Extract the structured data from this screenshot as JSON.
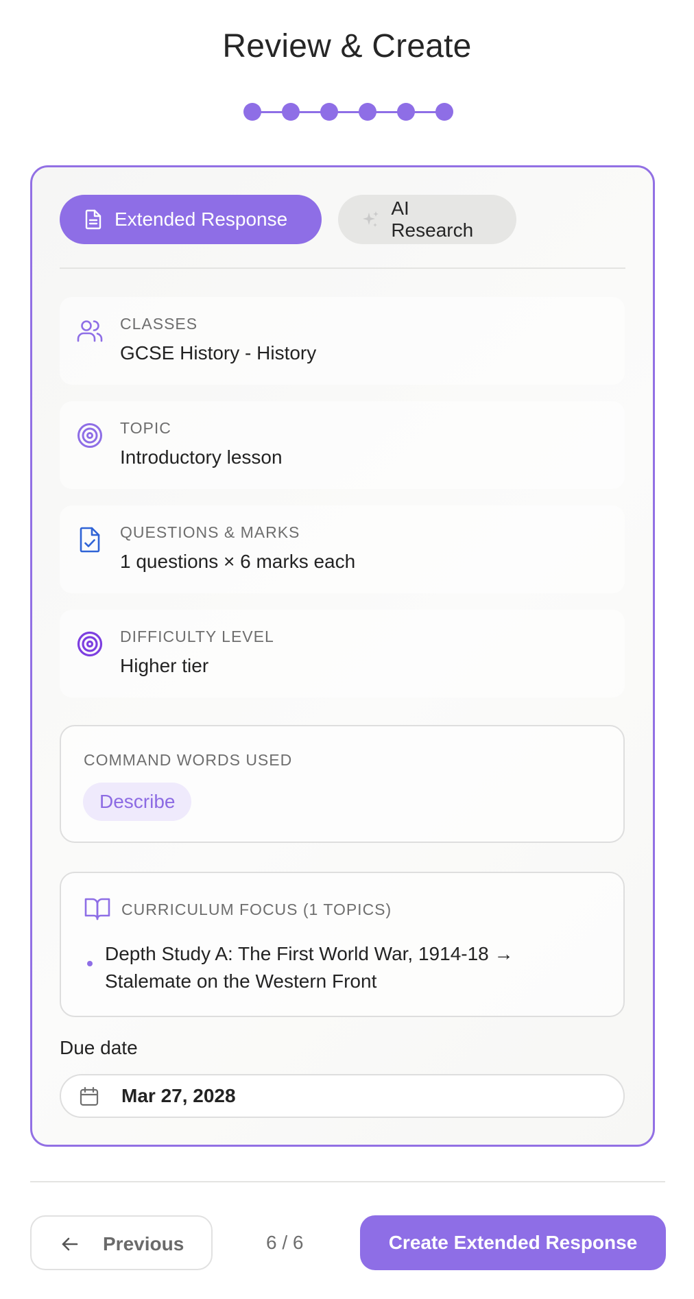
{
  "page": {
    "title": "Review & Create"
  },
  "stepper": {
    "total_steps": 6,
    "current_step": 6
  },
  "mode_tabs": [
    {
      "label": "Extended Response",
      "icon": "document-icon",
      "active": true
    },
    {
      "label": "AI Research",
      "icon": "sparkles-icon",
      "active": false
    }
  ],
  "summary": {
    "classes": {
      "label": "CLASSES",
      "value": "GCSE History - History",
      "icon": "users-icon"
    },
    "topic": {
      "label": "TOPIC",
      "value": "Introductory lesson",
      "icon": "target-icon"
    },
    "questions": {
      "label": "QUESTIONS & MARKS",
      "value": "1 questions × 6 marks each",
      "icon": "file-check-icon"
    },
    "difficulty": {
      "label": "DIFFICULTY LEVEL",
      "value": "Higher tier",
      "icon": "target-icon"
    }
  },
  "command_words": {
    "label": "COMMAND WORDS USED",
    "items": [
      "Describe"
    ]
  },
  "curriculum": {
    "label": "CURRICULUM FOCUS (1 TOPICS)",
    "icon": "book-open-icon",
    "topics": [
      "Depth Study A: The First World War, 1914-18 → Stalemate on the Western Front"
    ]
  },
  "due_date": {
    "label": "Due date",
    "value": "Mar 27, 2028",
    "icon": "calendar-icon"
  },
  "footer": {
    "previous_label": "Previous",
    "page_indicator": "6 / 6",
    "create_label": "Create Extended Response"
  },
  "colors": {
    "accent": "#8e6ee6",
    "chip_bg": "#efeafc",
    "icon_blue": "#2f63d6"
  }
}
